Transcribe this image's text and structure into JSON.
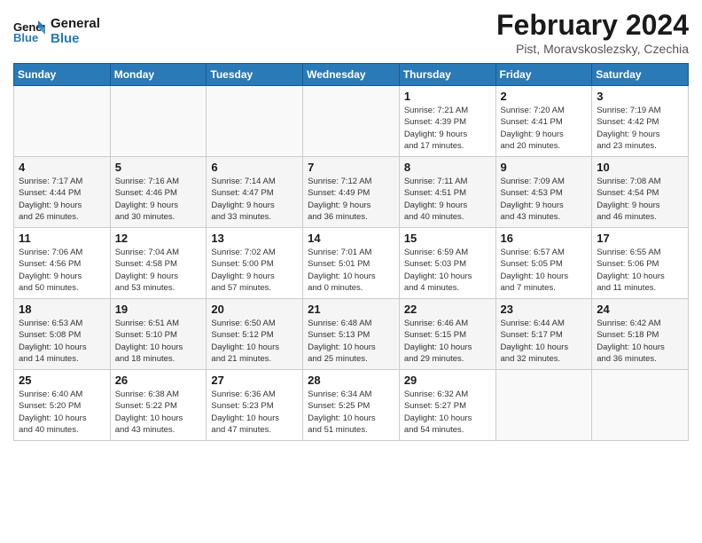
{
  "logo": {
    "line1": "General",
    "line2": "Blue"
  },
  "title": "February 2024",
  "subtitle": "Pist, Moravskoslezsky, Czechia",
  "days_header": [
    "Sunday",
    "Monday",
    "Tuesday",
    "Wednesday",
    "Thursday",
    "Friday",
    "Saturday"
  ],
  "weeks": [
    [
      {
        "day": "",
        "info": ""
      },
      {
        "day": "",
        "info": ""
      },
      {
        "day": "",
        "info": ""
      },
      {
        "day": "",
        "info": ""
      },
      {
        "day": "1",
        "info": "Sunrise: 7:21 AM\nSunset: 4:39 PM\nDaylight: 9 hours\nand 17 minutes."
      },
      {
        "day": "2",
        "info": "Sunrise: 7:20 AM\nSunset: 4:41 PM\nDaylight: 9 hours\nand 20 minutes."
      },
      {
        "day": "3",
        "info": "Sunrise: 7:19 AM\nSunset: 4:42 PM\nDaylight: 9 hours\nand 23 minutes."
      }
    ],
    [
      {
        "day": "4",
        "info": "Sunrise: 7:17 AM\nSunset: 4:44 PM\nDaylight: 9 hours\nand 26 minutes."
      },
      {
        "day": "5",
        "info": "Sunrise: 7:16 AM\nSunset: 4:46 PM\nDaylight: 9 hours\nand 30 minutes."
      },
      {
        "day": "6",
        "info": "Sunrise: 7:14 AM\nSunset: 4:47 PM\nDaylight: 9 hours\nand 33 minutes."
      },
      {
        "day": "7",
        "info": "Sunrise: 7:12 AM\nSunset: 4:49 PM\nDaylight: 9 hours\nand 36 minutes."
      },
      {
        "day": "8",
        "info": "Sunrise: 7:11 AM\nSunset: 4:51 PM\nDaylight: 9 hours\nand 40 minutes."
      },
      {
        "day": "9",
        "info": "Sunrise: 7:09 AM\nSunset: 4:53 PM\nDaylight: 9 hours\nand 43 minutes."
      },
      {
        "day": "10",
        "info": "Sunrise: 7:08 AM\nSunset: 4:54 PM\nDaylight: 9 hours\nand 46 minutes."
      }
    ],
    [
      {
        "day": "11",
        "info": "Sunrise: 7:06 AM\nSunset: 4:56 PM\nDaylight: 9 hours\nand 50 minutes."
      },
      {
        "day": "12",
        "info": "Sunrise: 7:04 AM\nSunset: 4:58 PM\nDaylight: 9 hours\nand 53 minutes."
      },
      {
        "day": "13",
        "info": "Sunrise: 7:02 AM\nSunset: 5:00 PM\nDaylight: 9 hours\nand 57 minutes."
      },
      {
        "day": "14",
        "info": "Sunrise: 7:01 AM\nSunset: 5:01 PM\nDaylight: 10 hours\nand 0 minutes."
      },
      {
        "day": "15",
        "info": "Sunrise: 6:59 AM\nSunset: 5:03 PM\nDaylight: 10 hours\nand 4 minutes."
      },
      {
        "day": "16",
        "info": "Sunrise: 6:57 AM\nSunset: 5:05 PM\nDaylight: 10 hours\nand 7 minutes."
      },
      {
        "day": "17",
        "info": "Sunrise: 6:55 AM\nSunset: 5:06 PM\nDaylight: 10 hours\nand 11 minutes."
      }
    ],
    [
      {
        "day": "18",
        "info": "Sunrise: 6:53 AM\nSunset: 5:08 PM\nDaylight: 10 hours\nand 14 minutes."
      },
      {
        "day": "19",
        "info": "Sunrise: 6:51 AM\nSunset: 5:10 PM\nDaylight: 10 hours\nand 18 minutes."
      },
      {
        "day": "20",
        "info": "Sunrise: 6:50 AM\nSunset: 5:12 PM\nDaylight: 10 hours\nand 21 minutes."
      },
      {
        "day": "21",
        "info": "Sunrise: 6:48 AM\nSunset: 5:13 PM\nDaylight: 10 hours\nand 25 minutes."
      },
      {
        "day": "22",
        "info": "Sunrise: 6:46 AM\nSunset: 5:15 PM\nDaylight: 10 hours\nand 29 minutes."
      },
      {
        "day": "23",
        "info": "Sunrise: 6:44 AM\nSunset: 5:17 PM\nDaylight: 10 hours\nand 32 minutes."
      },
      {
        "day": "24",
        "info": "Sunrise: 6:42 AM\nSunset: 5:18 PM\nDaylight: 10 hours\nand 36 minutes."
      }
    ],
    [
      {
        "day": "25",
        "info": "Sunrise: 6:40 AM\nSunset: 5:20 PM\nDaylight: 10 hours\nand 40 minutes."
      },
      {
        "day": "26",
        "info": "Sunrise: 6:38 AM\nSunset: 5:22 PM\nDaylight: 10 hours\nand 43 minutes."
      },
      {
        "day": "27",
        "info": "Sunrise: 6:36 AM\nSunset: 5:23 PM\nDaylight: 10 hours\nand 47 minutes."
      },
      {
        "day": "28",
        "info": "Sunrise: 6:34 AM\nSunset: 5:25 PM\nDaylight: 10 hours\nand 51 minutes."
      },
      {
        "day": "29",
        "info": "Sunrise: 6:32 AM\nSunset: 5:27 PM\nDaylight: 10 hours\nand 54 minutes."
      },
      {
        "day": "",
        "info": ""
      },
      {
        "day": "",
        "info": ""
      }
    ]
  ]
}
